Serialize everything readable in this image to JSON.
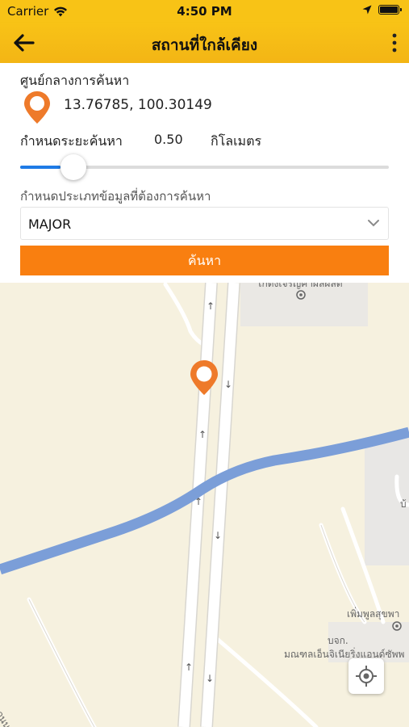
{
  "status_bar": {
    "carrier": "Carrier",
    "time": "4:50 PM",
    "icons": [
      "wifi-icon",
      "location-arrow-icon",
      "battery-icon"
    ]
  },
  "nav": {
    "title": "สถานที่ใกล้เคียง",
    "back_icon": "back-arrow-icon",
    "menu_icon": "more-vertical-icon"
  },
  "form": {
    "center_label": "ศูนย์กลางการค้นหา",
    "coordinates": "13.76785, 100.30149",
    "distance_label": "กำหนดระยะค้นหา",
    "distance_value": "0.50",
    "distance_unit": "กิโลเมตร",
    "slider_level": 0.11,
    "type_label": "กำหนดประเภทข้อมูลที่ต้องการค้นหา",
    "type_selected": "MAJOR",
    "search_button": "ค้นหา"
  },
  "map": {
    "labels": {
      "poi_top": "โกดังเจริญค้าผลผลิต",
      "poi_right": "เพิ่มพูลสุขพา",
      "company_prefix": "บจก.",
      "company_name": "มณฑลเอ็นจิเนียริ่งแอนด์ซัพพ",
      "edge_right": "บ้",
      "edge_left": "ถนน"
    },
    "locate_icon": "my-location-icon"
  },
  "colors": {
    "header": "#f8c316",
    "accent": "#f97f10",
    "slider": "#1e7be6",
    "pin": "#ee7a2a",
    "water": "#7b9ed8",
    "map_bg": "#f6f1df"
  }
}
